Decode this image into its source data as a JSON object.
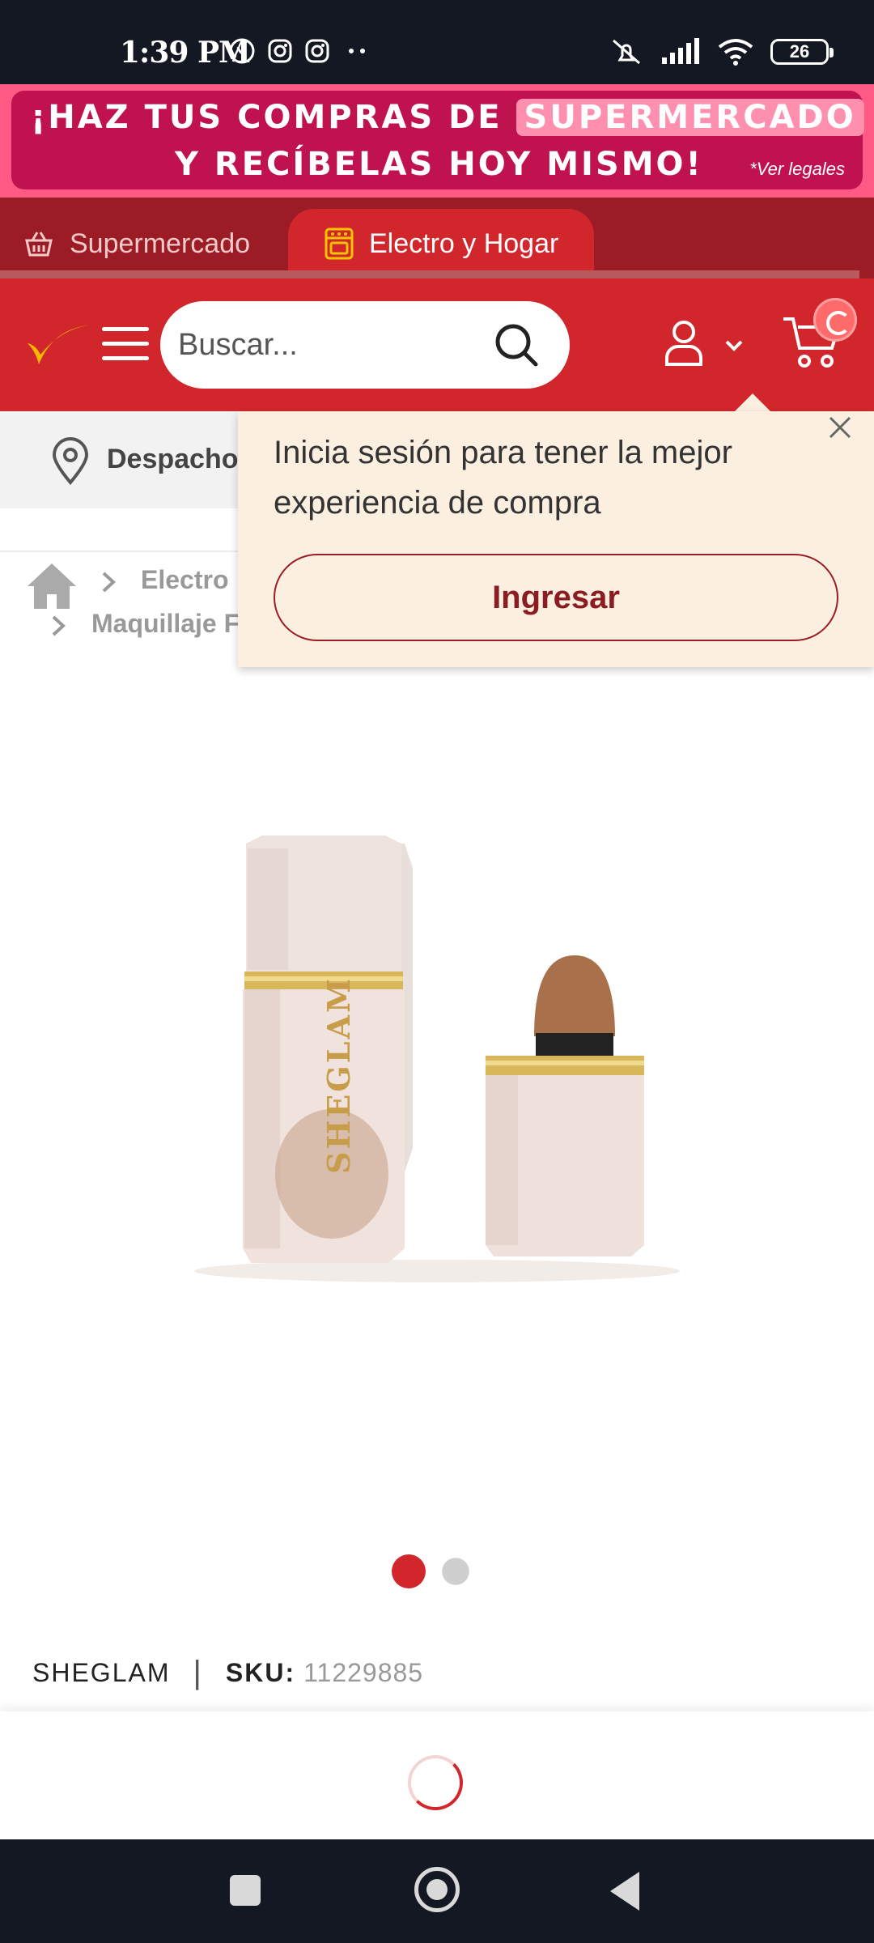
{
  "status_bar": {
    "time": "1:39 PM",
    "battery": "26",
    "notification_icons": [
      "whatsapp-icon",
      "instagram-icon",
      "instagram-icon",
      "more-dots-icon"
    ],
    "system_icons": [
      "mute-vibrate-icon",
      "signal-icon",
      "wifi-icon",
      "battery-icon"
    ]
  },
  "promo": {
    "line1_prefix": "¡HAZ TUS COMPRAS DE",
    "line1_highlight": "SUPERMERCADO",
    "line2": "Y RECÍBELAS HOY MISMO!",
    "legal": "*Ver legales"
  },
  "tabs": [
    {
      "label": "Supermercado",
      "icon": "basket-icon",
      "active": false
    },
    {
      "label": "Electro y Hogar",
      "icon": "stove-icon",
      "active": true
    }
  ],
  "header": {
    "search_placeholder": "Buscar...",
    "cart_count": ""
  },
  "delivery": {
    "label": "Despacho"
  },
  "breadcrumb": {
    "items": [
      "Electro",
      "Maquillaje F"
    ]
  },
  "login_popover": {
    "message": "Inicia sesión para tener la mejor experiencia de compra",
    "button": "Ingresar"
  },
  "product": {
    "image_brand_text": "SHEGLAM",
    "brand": "SHEGLAM",
    "sku_label": "SKU:",
    "sku": "11229885",
    "carousel_total": 2,
    "carousel_active": 1
  },
  "colors": {
    "primary_red": "#d2262d",
    "dark_red": "#9b1c24",
    "promo_pink": "#ff5a85",
    "promo_magenta": "#c0124f",
    "popover_bg": "#fbefe0"
  }
}
